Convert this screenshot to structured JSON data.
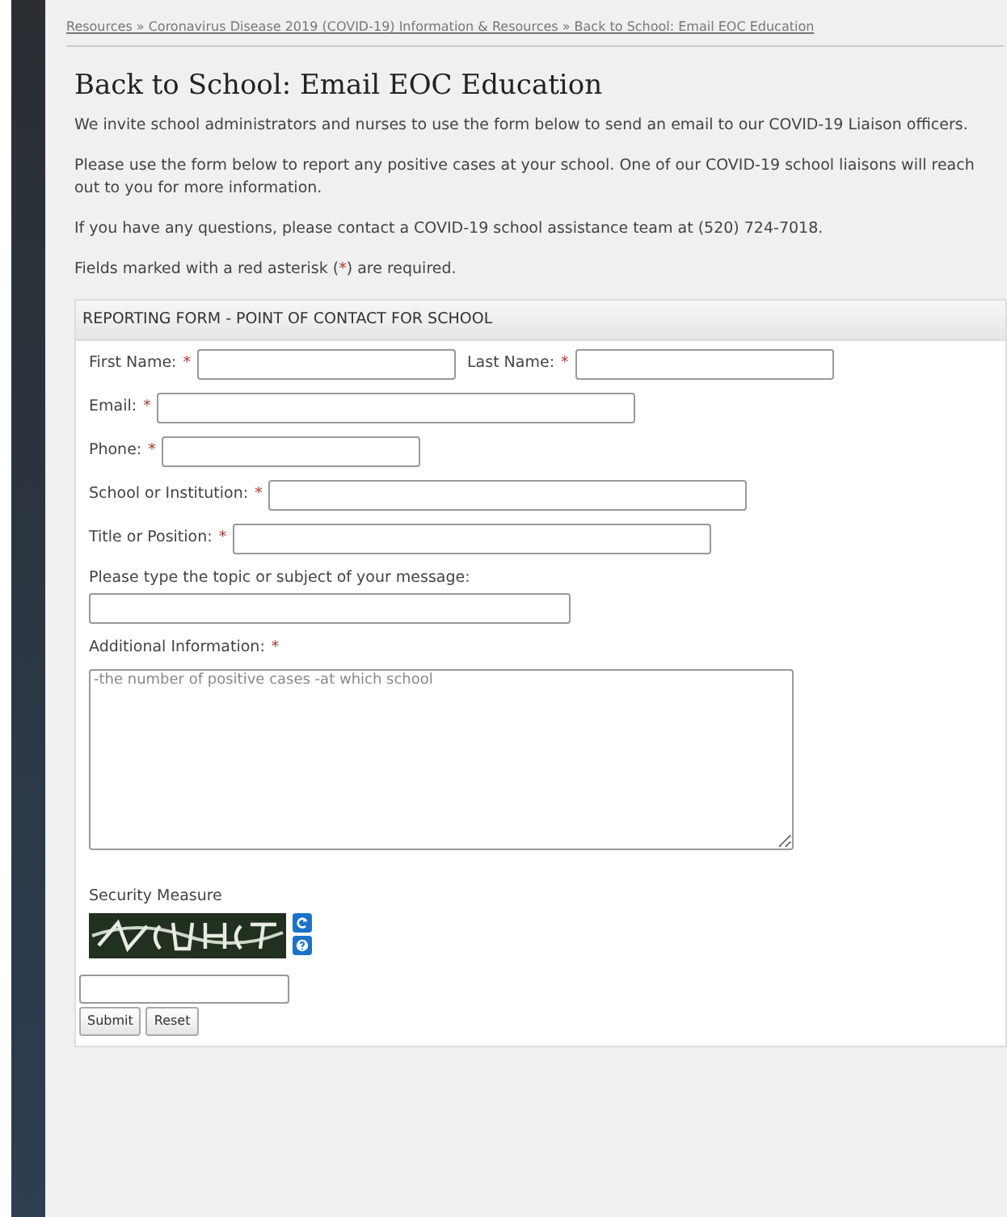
{
  "breadcrumb": "Resources » Coronavirus Disease 2019 (COVID-19) Information & Resources » Back to School: Email EOC Education",
  "title": "Back to School: Email EOC Education",
  "paragraphs": [
    "We invite school administrators and nurses to use the form below to send an email to our COVID-19 Liaison officers.",
    "Please use the form below to report any positive cases at your school. One of our COVID-19 school liaisons will reach out to you for more information.",
    "If you have any questions, please contact a COVID-19 school assistance team at (520) 724-7018."
  ],
  "required_note": {
    "before": "Fields marked with a red asterisk (",
    "mark": "*",
    "after": ") are required."
  },
  "form": {
    "header": "REPORTING FORM - POINT OF CONTACT FOR SCHOOL",
    "rows": [
      [
        {
          "label": "First Name:",
          "required": true
        },
        {
          "label": "Last Name:",
          "required": true
        }
      ],
      [
        {
          "label": "Email:",
          "required": true
        }
      ],
      [
        {
          "label": "Phone:",
          "required": true
        }
      ],
      [
        {
          "label": "School or Institution:",
          "required": true
        }
      ],
      [
        {
          "label": "Title or Position:",
          "required": true
        }
      ]
    ],
    "subject": {
      "label": "Please type the topic or subject of your message:",
      "required": false
    },
    "additional": {
      "label": "Additional Information:",
      "required": true,
      "placeholder": "-the number of positive cases -at which school"
    },
    "security": {
      "label": "Security Measure"
    },
    "buttons": [
      "Submit",
      "Reset"
    ]
  }
}
